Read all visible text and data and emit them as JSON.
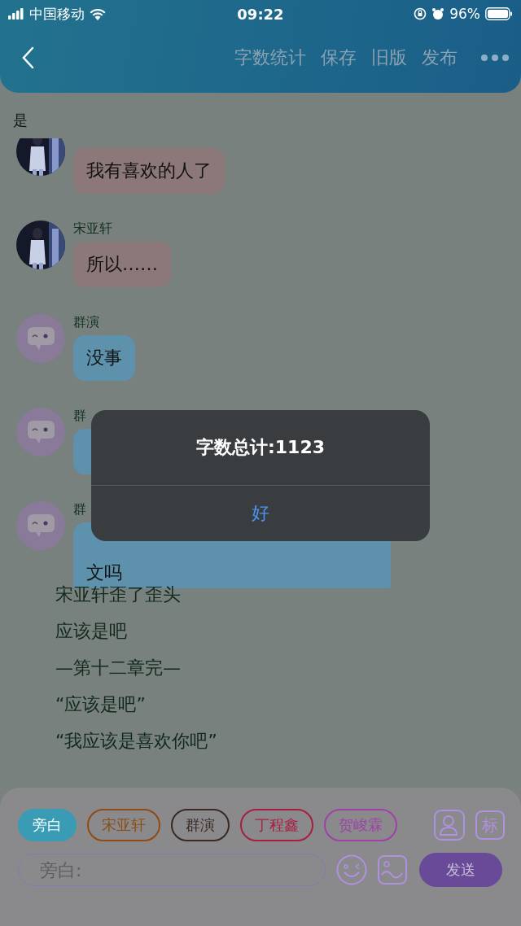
{
  "status_bar": {
    "carrier": "中国移动",
    "time": "09:22",
    "battery": "96%"
  },
  "header": {
    "actions": [
      "字数统计",
      "保存",
      "旧版",
      "发布"
    ]
  },
  "top_line": "是",
  "messages": [
    {
      "text": "我有喜欢的人了",
      "color": "#8c7878"
    },
    {
      "sender": "宋亚轩",
      "text": "所以……",
      "color": "#8c7878"
    },
    {
      "kind": "mascot",
      "sender": "群演",
      "text": "没事",
      "color": "#5e92ac"
    },
    {
      "kind": "mascot",
      "sender": "群",
      "color": "#5e92ac"
    },
    {
      "kind": "mascot",
      "sender": "群",
      "text": "文吗",
      "continued": true,
      "color": "#5e92ac"
    }
  ],
  "narration": [
    "宋亚轩歪了歪头",
    "应该是吧",
    "—第十二章完—",
    "“应该是吧”",
    "“我应该是喜欢你吧”"
  ],
  "roles": [
    {
      "label": "旁白",
      "selected": true,
      "color": "#3a9cb4"
    },
    {
      "label": "宋亚轩",
      "selected": false,
      "color": "#8e4c14"
    },
    {
      "label": "群演",
      "selected": false,
      "color": "#3a2a24"
    },
    {
      "label": "丁程鑫",
      "selected": false,
      "color": "#a81e40"
    },
    {
      "label": "贺峻霖",
      "selected": false,
      "color": "#a040a8"
    }
  ],
  "tag_button": "标",
  "input": {
    "placeholder": "旁白:"
  },
  "send_button": "发送",
  "dialog": {
    "title": "字数总计:1123",
    "button": "好"
  }
}
